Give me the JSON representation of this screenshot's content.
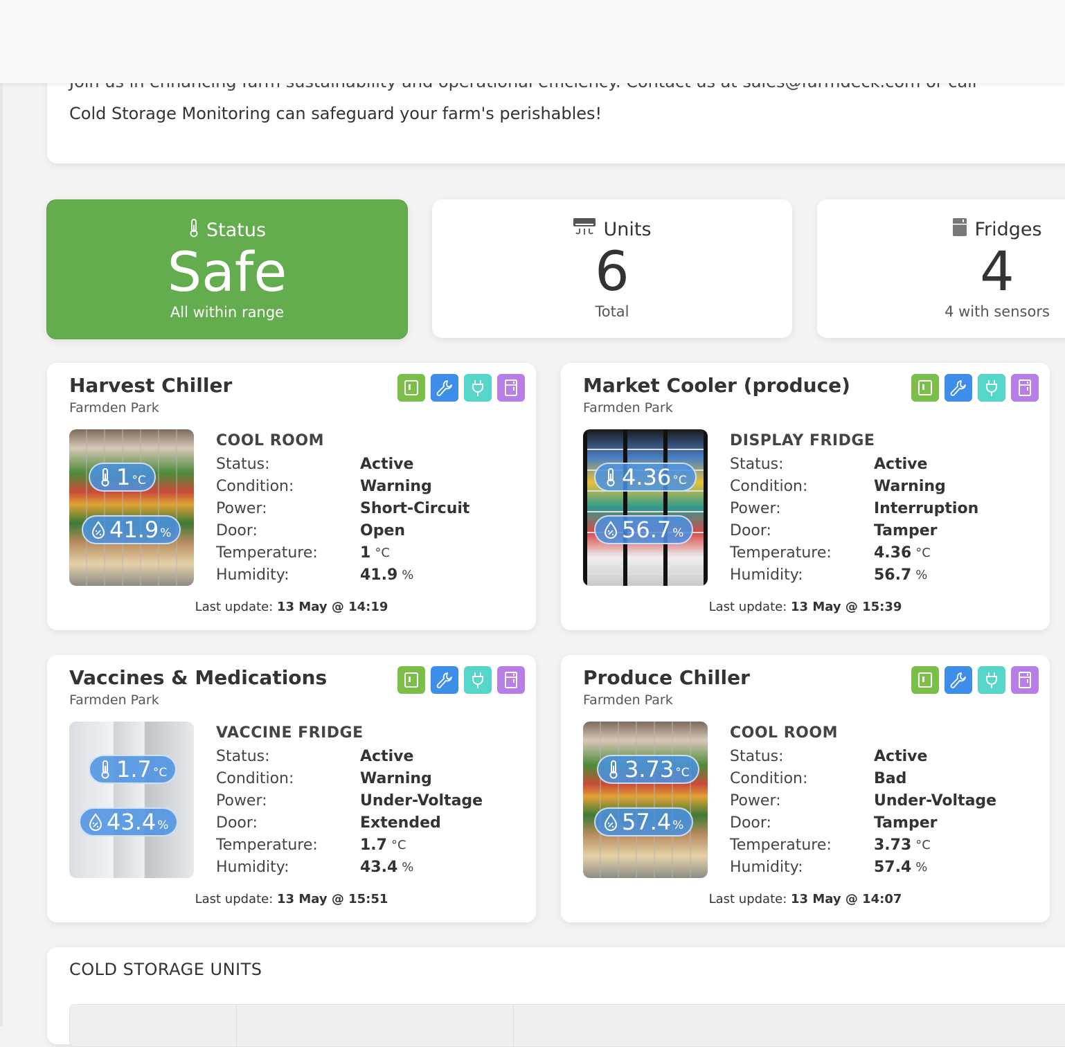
{
  "intro": {
    "cut_line": "Join us in enhancing farm sustainability and operational efficiency. Contact us at sales@farmdeck.com or call",
    "line2": "Cold Storage Monitoring can safeguard your farm's perishables!"
  },
  "stats": {
    "status": {
      "label": "Status",
      "value": "Safe",
      "sub": "All within range",
      "icon": "thermometer-icon",
      "color": "#63ad4e"
    },
    "units": {
      "label": "Units",
      "value": "6",
      "sub": "Total",
      "icon": "ac-unit-icon"
    },
    "fridges": {
      "label": "Fridges",
      "value": "4",
      "sub": "4 with sensors",
      "icon": "fridge-icon"
    }
  },
  "labels": {
    "status": "Status:",
    "condition": "Condition:",
    "power": "Power:",
    "door": "Door:",
    "temperature": "Temperature:",
    "humidity": "Humidity:",
    "last_update": "Last update:",
    "temp_unit": "°C",
    "hum_unit": "%"
  },
  "cards": [
    {
      "title": "Harvest Chiller",
      "location": "Farmden Park",
      "type": "COOL ROOM",
      "status": "Active",
      "condition": "Warning",
      "power": "Short-Circuit",
      "door": "Open",
      "temperature": "1",
      "humidity": "41.9",
      "updated": "13 May @ 14:19"
    },
    {
      "title": "Market Cooler (produce)",
      "location": "Farmden Park",
      "type": "DISPLAY FRIDGE",
      "status": "Active",
      "condition": "Warning",
      "power": "Interruption",
      "door": "Tamper",
      "temperature": "4.36",
      "humidity": "56.7",
      "updated": "13 May @ 15:39"
    },
    {
      "title": "Vaccines & Medications",
      "location": "Farmden Park",
      "type": "VACCINE FRIDGE",
      "status": "Active",
      "condition": "Warning",
      "power": "Under-Voltage",
      "door": "Extended",
      "temperature": "1.7",
      "humidity": "43.4",
      "updated": "13 May @ 15:51"
    },
    {
      "title": "Produce Chiller",
      "location": "Farmden Park",
      "type": "COOL ROOM",
      "status": "Active",
      "condition": "Bad",
      "power": "Under-Voltage",
      "door": "Tamper",
      "temperature": "3.73",
      "humidity": "57.4",
      "updated": "13 May @ 14:07"
    }
  ],
  "card_icons": [
    {
      "name": "condition-icon",
      "color": "#7bbf49"
    },
    {
      "name": "wrench-icon",
      "color": "#3d8ee8"
    },
    {
      "name": "plug-icon",
      "color": "#56d6c9"
    },
    {
      "name": "door-icon",
      "color": "#b77ee6"
    }
  ],
  "units_table": {
    "heading": "COLD STORAGE UNITS"
  }
}
